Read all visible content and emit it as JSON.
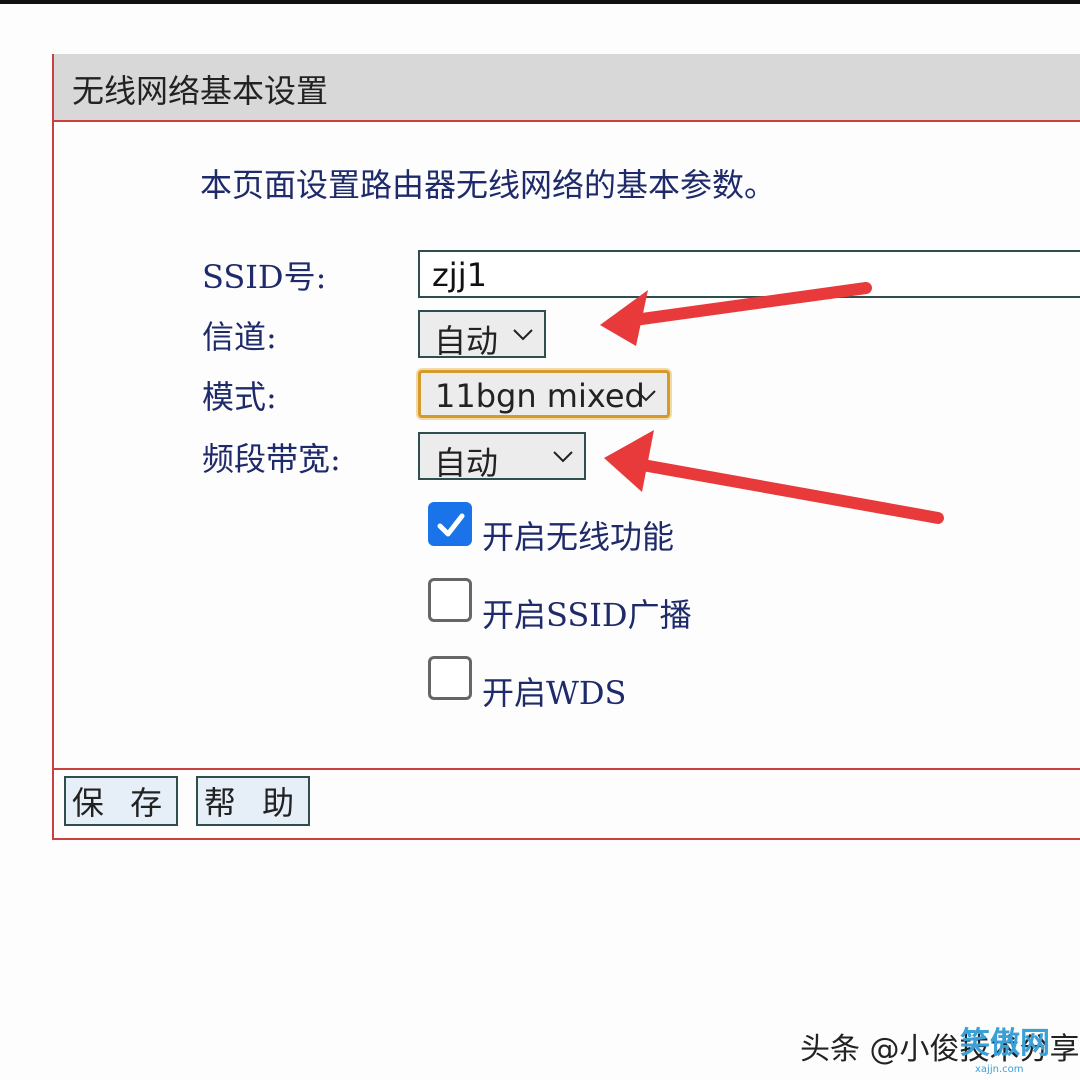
{
  "panel": {
    "title": "无线网络基本设置",
    "intro": "本页面设置路由器无线网络的基本参数。"
  },
  "form": {
    "ssid_label": "SSID号:",
    "ssid_value": "zjj1",
    "channel_label": "信道:",
    "channel_value": "自动",
    "mode_label": "模式:",
    "mode_value": "11bgn mixed",
    "bandwidth_label": "频段带宽:",
    "bandwidth_value": "自动",
    "enable_wireless_label": "开启无线功能",
    "enable_wireless_checked": true,
    "enable_ssid_broadcast_label": "开启SSID广播",
    "enable_ssid_broadcast_checked": false,
    "enable_wds_label": "开启WDS",
    "enable_wds_checked": false
  },
  "buttons": {
    "save": "保 存",
    "help": "帮 助"
  },
  "watermark": {
    "text": "头条 @小俊技术分享",
    "logo": "笑傲网",
    "site": "xajjn.com"
  },
  "colors": {
    "accent_blue": "#1a73e8",
    "annotation_red": "#e83a3a",
    "border_red": "#c84040",
    "focus_orange": "#d49a2a"
  },
  "icons": [
    "chevron-down-icon",
    "checkmark-icon",
    "annotation-arrow"
  ]
}
